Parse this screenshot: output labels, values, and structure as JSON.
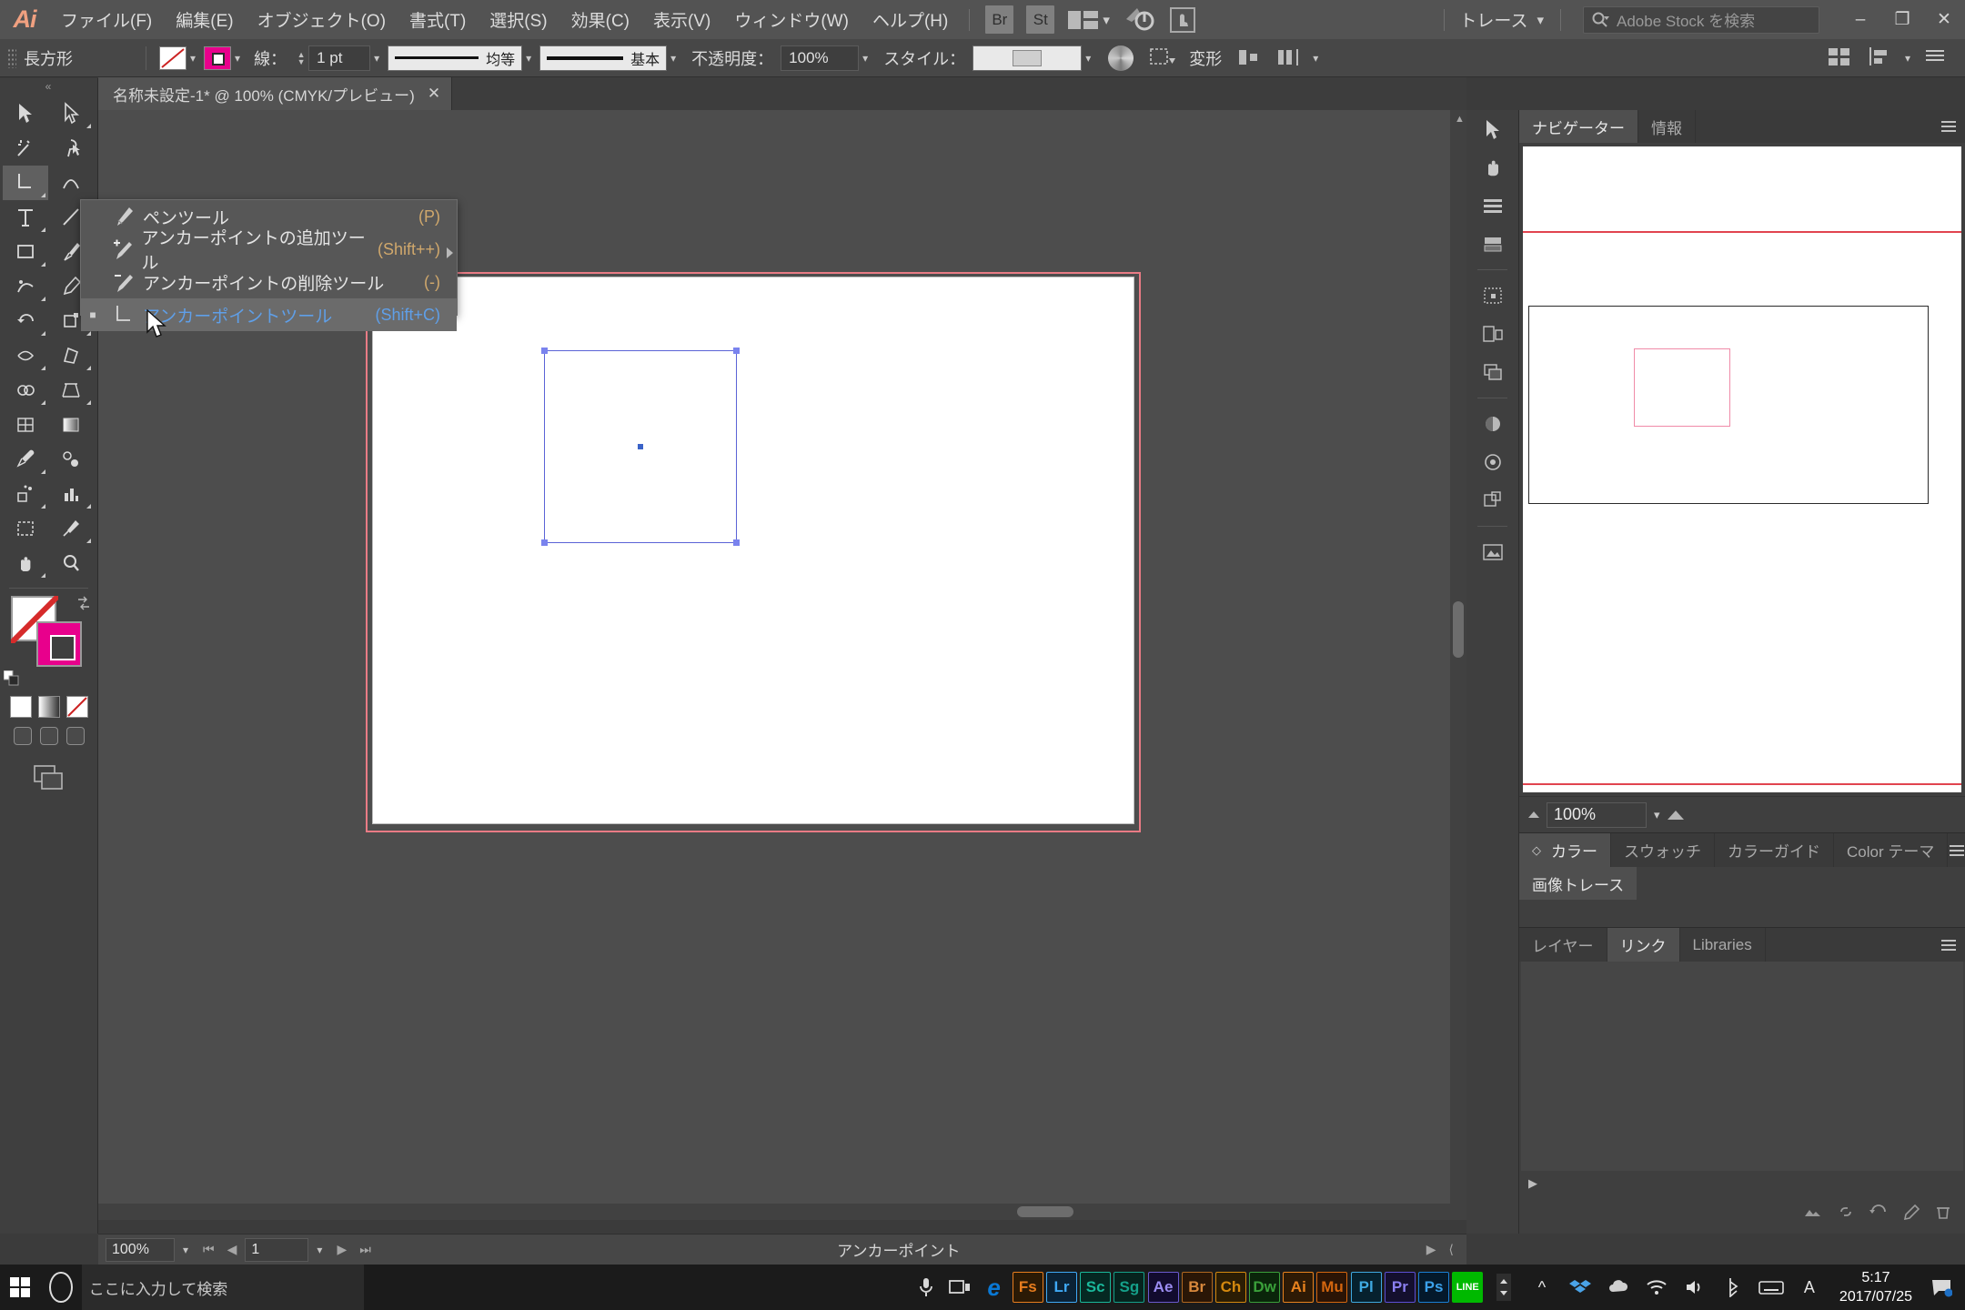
{
  "app": {
    "name": "Adobe Illustrator",
    "logo_text": "Ai",
    "trace_label": "トレース"
  },
  "menubar": {
    "items": [
      {
        "label": "ファイル(F)"
      },
      {
        "label": "編集(E)"
      },
      {
        "label": "オブジェクト(O)"
      },
      {
        "label": "書式(T)"
      },
      {
        "label": "選択(S)"
      },
      {
        "label": "効果(C)"
      },
      {
        "label": "表示(V)"
      },
      {
        "label": "ウィンドウ(W)"
      },
      {
        "label": "ヘルプ(H)"
      }
    ],
    "bridge_label": "Br",
    "stock_label": "St",
    "search": {
      "placeholder": "Adobe Stock を検索",
      "value": ""
    },
    "window_buttons": {
      "minimize": "–",
      "restore": "❐",
      "close": "✕"
    }
  },
  "optionsbar": {
    "object_label": "長方形",
    "fill_color": "#FFFFFF",
    "stroke_color": "#E8008C",
    "stroke_label": "線：",
    "stroke_weight": "1 pt",
    "profile_label": "均等",
    "brush_label": "基本",
    "opacity_label": "不透明度：",
    "opacity_value": "100%",
    "style_label": "スタイル：",
    "transform_label": "変形"
  },
  "tabbar": {
    "document_title": "名称未設定-1* @ 100% (CMYK/プレビュー)",
    "close_glyph": "✕"
  },
  "flyout": {
    "items": [
      {
        "label": "ペンツール",
        "shortcut": "(P)",
        "icon": "pen-tool-icon",
        "selected": false
      },
      {
        "label": "アンカーポイントの追加ツール",
        "shortcut": "(Shift++)",
        "icon": "add-anchor-point-tool-icon",
        "selected": false
      },
      {
        "label": "アンカーポイントの削除ツール",
        "shortcut": "(-)",
        "icon": "delete-anchor-point-tool-icon",
        "selected": false
      },
      {
        "label": "アンカーポイントツール",
        "shortcut": "(Shift+C)",
        "icon": "anchor-point-tool-icon",
        "selected": true
      }
    ]
  },
  "statusbar": {
    "zoom": "100%",
    "artboard_number": "1",
    "status_text": "アンカーポイント"
  },
  "navigator": {
    "tabs": [
      {
        "label": "ナビゲーター",
        "active": true
      },
      {
        "label": "情報",
        "active": false
      }
    ],
    "zoom": "100%"
  },
  "color_panel": {
    "tabs": [
      {
        "label": "カラー",
        "active": true
      },
      {
        "label": "スウォッチ",
        "active": false
      },
      {
        "label": "カラーガイド",
        "active": false
      },
      {
        "label": "Color テーマ",
        "active": false
      }
    ]
  },
  "trace_panel": {
    "tab_label": "画像トレース"
  },
  "layers_panel": {
    "tabs": [
      {
        "label": "レイヤー",
        "active": false
      },
      {
        "label": "リンク",
        "active": true
      },
      {
        "label": "Libraries",
        "active": false
      }
    ]
  },
  "taskbar": {
    "search_placeholder": "ここに入力して検索",
    "apps": [
      {
        "label": "e",
        "color": "#0a78d4",
        "name": "edge"
      },
      {
        "label": "Fs",
        "color": "#e87d1e",
        "name": "fuse"
      },
      {
        "label": "Lr",
        "color": "#3fa9f5",
        "name": "lightroom"
      },
      {
        "label": "Sc",
        "color": "#1ab89b",
        "name": "scout"
      },
      {
        "label": "Sg",
        "color": "#15a08a",
        "name": "speedgrade"
      },
      {
        "label": "Ae",
        "color": "#6a5acd",
        "name": "aftereffects"
      },
      {
        "label": "Br",
        "color": "#b06820",
        "name": "bridge"
      },
      {
        "label": "Ch",
        "color": "#d4890f",
        "name": "characteranimator"
      },
      {
        "label": "Dw",
        "color": "#3aa03a",
        "name": "dreamweaver"
      },
      {
        "label": "Ai",
        "color": "#e8821e",
        "name": "illustrator"
      },
      {
        "label": "Mu",
        "color": "#d4660f",
        "name": "muse"
      },
      {
        "label": "Pl",
        "color": "#3fa9e0",
        "name": "prelude"
      },
      {
        "label": "Pr",
        "color": "#5c4fd4",
        "name": "premiere"
      },
      {
        "label": "Ps",
        "color": "#1a7fd4",
        "name": "photoshop"
      },
      {
        "label": "LINE",
        "color": "#00b900",
        "name": "line"
      }
    ],
    "clock_time": "5:17",
    "clock_date": "2017/07/25"
  }
}
